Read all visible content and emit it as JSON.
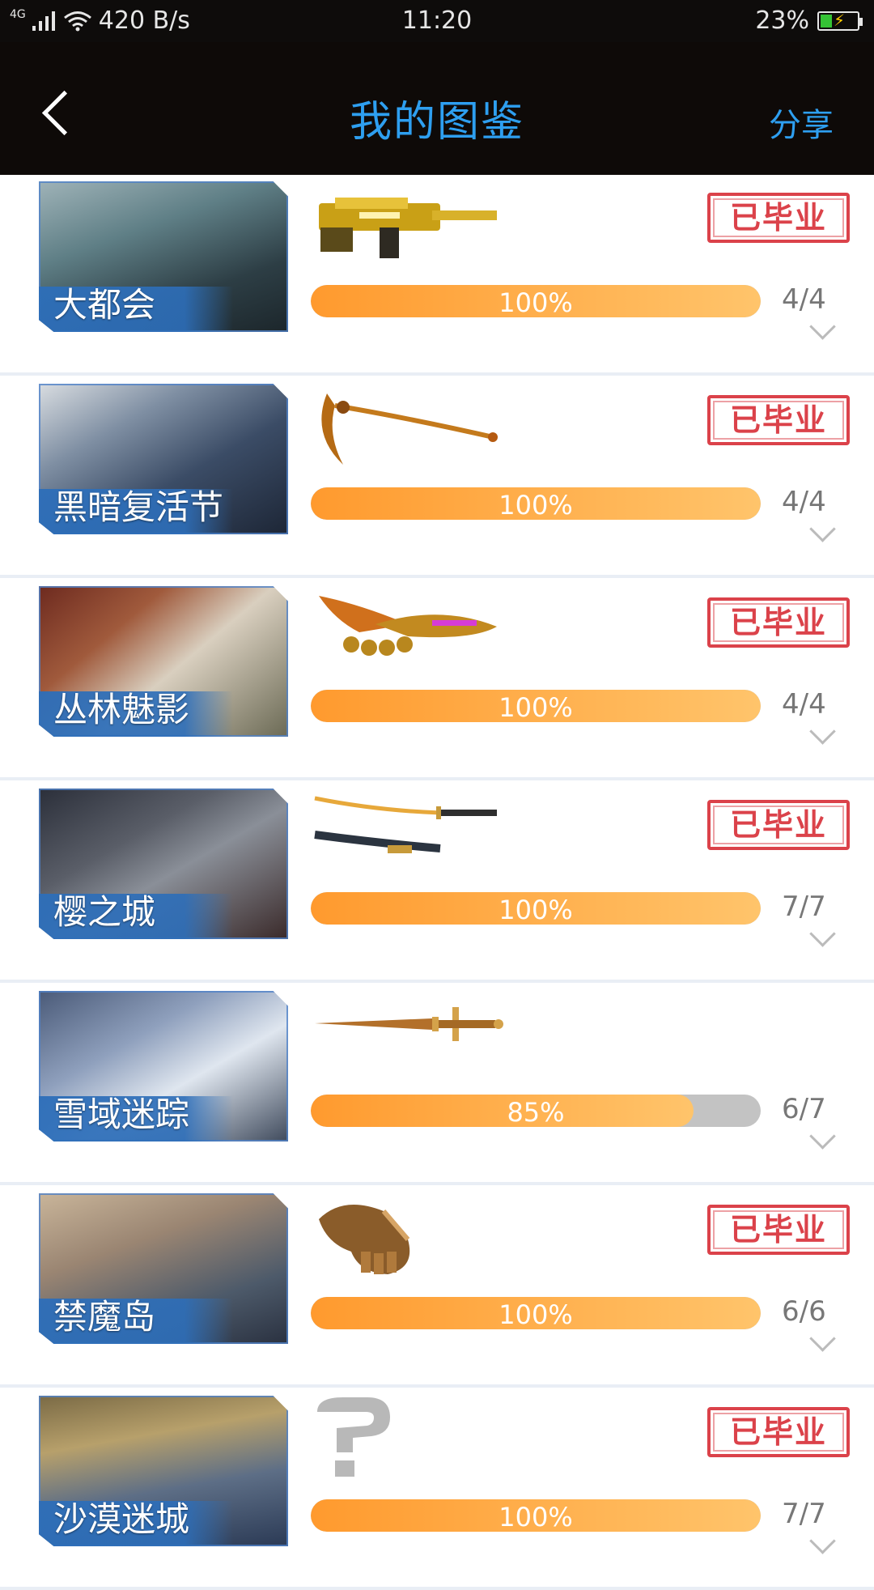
{
  "status_bar": {
    "network": "4G",
    "speed": "420 B/s",
    "time": "11:20",
    "battery": "23%",
    "battery_level": 0.23
  },
  "header": {
    "back_icon": "chevron-left-icon",
    "title": "我的图鉴",
    "share_label": "分享"
  },
  "items": [
    {
      "name": "大都会",
      "percent_label": "100%",
      "progress": 1.0,
      "count": "4/4",
      "badge": "已毕业",
      "graduated": true,
      "weapon": "gold-rifle"
    },
    {
      "name": "黑暗复活节",
      "percent_label": "100%",
      "progress": 1.0,
      "count": "4/4",
      "badge": "已毕业",
      "graduated": true,
      "weapon": "scythe"
    },
    {
      "name": "丛林魅影",
      "percent_label": "100%",
      "progress": 1.0,
      "count": "4/4",
      "badge": "已毕业",
      "graduated": true,
      "weapon": "knuckle-blade"
    },
    {
      "name": "樱之城",
      "percent_label": "100%",
      "progress": 1.0,
      "count": "7/7",
      "badge": "已毕业",
      "graduated": true,
      "weapon": "katana"
    },
    {
      "name": "雪域迷踪",
      "percent_label": "85%",
      "progress": 0.85,
      "count": "6/7",
      "badge": "",
      "graduated": false,
      "weapon": "sword"
    },
    {
      "name": "禁魔岛",
      "percent_label": "100%",
      "progress": 1.0,
      "count": "6/6",
      "badge": "已毕业",
      "graduated": true,
      "weapon": "gauntlet"
    },
    {
      "name": "沙漠迷城",
      "percent_label": "100%",
      "progress": 1.0,
      "count": "7/7",
      "badge": "已毕业",
      "graduated": true,
      "weapon": "unknown-question-mark"
    }
  ]
}
